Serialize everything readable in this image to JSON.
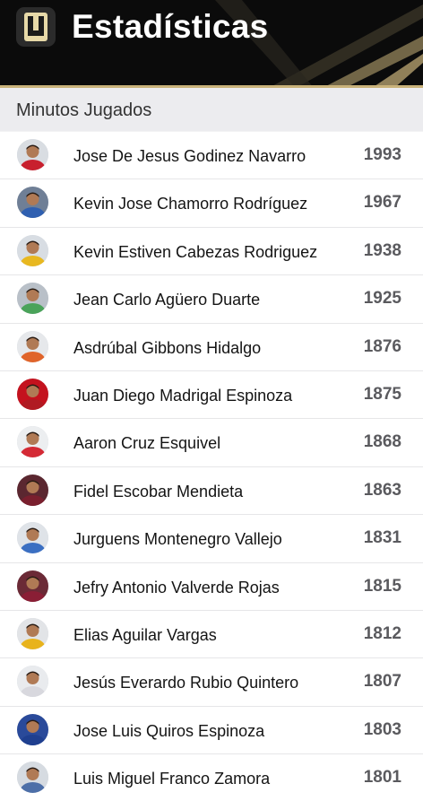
{
  "header": {
    "title": "Estadísticas",
    "logo_letter": "U",
    "logo_icon": "club-shield-icon"
  },
  "section": {
    "title": "Minutos Jugados"
  },
  "colors": {
    "header_bg": "#0b0b0b",
    "accent_gold": "#c9b27a",
    "minutes_text": "#5a5a5e"
  },
  "players": [
    {
      "name": "Jose De Jesus Godinez Navarro",
      "minutes": "1993",
      "jersey": "#c8202e",
      "bg": "#d9dde2"
    },
    {
      "name": "Kevin Jose Chamorro Rodríguez",
      "minutes": "1967",
      "jersey": "#2f5fb0",
      "bg": "#6f7f96"
    },
    {
      "name": "Kevin Estiven Cabezas Rodriguez",
      "minutes": "1938",
      "jersey": "#e8b820",
      "bg": "#d8dde3"
    },
    {
      "name": "Jean Carlo Agüero Duarte",
      "minutes": "1925",
      "jersey": "#4aa35a",
      "bg": "#b9c0c8"
    },
    {
      "name": "Asdrúbal Gibbons Hidalgo",
      "minutes": "1876",
      "jersey": "#e0642a",
      "bg": "#e6e8eb"
    },
    {
      "name": "Juan Diego Madrigal Espinoza",
      "minutes": "1875",
      "jersey": "#b01a22",
      "bg": "#c4121e"
    },
    {
      "name": "Aaron Cruz Esquivel",
      "minutes": "1868",
      "jersey": "#d42a35",
      "bg": "#eceef0"
    },
    {
      "name": "Fidel Escobar Mendieta",
      "minutes": "1863",
      "jersey": "#7a1f2e",
      "bg": "#5b2730"
    },
    {
      "name": "Jurguens Montenegro Vallejo",
      "minutes": "1831",
      "jersey": "#3b6fc2",
      "bg": "#dfe3e8"
    },
    {
      "name": "Jefry Antonio Valverde Rojas",
      "minutes": "1815",
      "jersey": "#8a1e35",
      "bg": "#6b2a36"
    },
    {
      "name": "Elias Aguilar Vargas",
      "minutes": "1812",
      "jersey": "#e8b31c",
      "bg": "#e2e4e7"
    },
    {
      "name": "Jesús Everardo Rubio Quintero",
      "minutes": "1807",
      "jersey": "#d8d8de",
      "bg": "#e9ebee"
    },
    {
      "name": "Jose Luis Quiros Espinoza",
      "minutes": "1803",
      "jersey": "#1f3f8f",
      "bg": "#2a4a9a"
    },
    {
      "name": "Luis Miguel Franco Zamora",
      "minutes": "1801",
      "jersey": "#4d6fa8",
      "bg": "#d6dbe1"
    }
  ]
}
